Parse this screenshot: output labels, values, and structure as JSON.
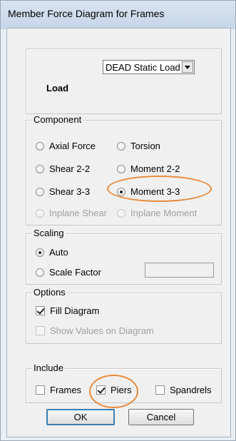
{
  "window": {
    "title": "Member Force Diagram for Frames"
  },
  "load": {
    "label": "Load",
    "selected": "DEAD Static Load"
  },
  "component": {
    "legend": "Component",
    "options": [
      {
        "label": "Axial Force",
        "checked": false,
        "disabled": false
      },
      {
        "label": "Torsion",
        "checked": false,
        "disabled": false
      },
      {
        "label": "Shear 2-2",
        "checked": false,
        "disabled": false
      },
      {
        "label": "Moment 2-2",
        "checked": false,
        "disabled": false
      },
      {
        "label": "Shear 3-3",
        "checked": false,
        "disabled": false
      },
      {
        "label": "Moment 3-3",
        "checked": true,
        "disabled": false
      },
      {
        "label": "Inplane Shear",
        "checked": false,
        "disabled": true
      },
      {
        "label": "Inplane Moment",
        "checked": false,
        "disabled": true
      }
    ]
  },
  "scaling": {
    "legend": "Scaling",
    "auto_label": "Auto",
    "scale_factor_label": "Scale Factor",
    "scale_factor_value": ""
  },
  "options": {
    "legend": "Options",
    "fill_label": "Fill Diagram",
    "show_values_label": "Show Values on Diagram"
  },
  "include": {
    "legend": "Include",
    "frames_label": "Frames",
    "piers_label": "Piers",
    "spandrels_label": "Spandrels"
  },
  "buttons": {
    "ok": "OK",
    "cancel": "Cancel"
  },
  "colors": {
    "highlight": "#e88a3c",
    "disabled_text": "#a0a0a0"
  }
}
